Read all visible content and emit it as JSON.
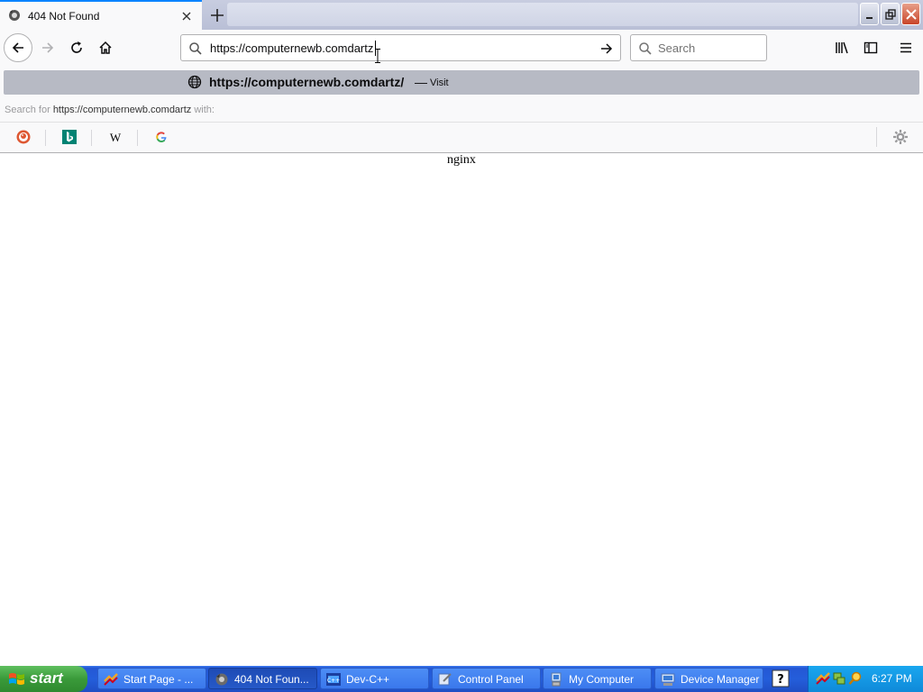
{
  "tab": {
    "title": "404 Not Found"
  },
  "nav": {
    "url": "https://computernewb.comdartz"
  },
  "search": {
    "placeholder": "Search"
  },
  "dropdown": {
    "suggestion_url": "https://computernewb.comdartz/",
    "suggestion_dash": "—",
    "suggestion_action": "Visit",
    "search_for_prefix": "Search for",
    "search_for_query": "https://computernewb.comdartz",
    "search_for_suffix": "with:",
    "engines": [
      "duckduckgo-icon",
      "bing-icon",
      "wikipedia-icon",
      "google-icon"
    ]
  },
  "page": {
    "server_text": "nginx"
  },
  "taskbar": {
    "start_label": "start",
    "tasks": [
      {
        "label": "Start Page - ...",
        "icon": "devcpp-icon"
      },
      {
        "label": "404 Not Foun...",
        "icon": "firefox-icon"
      },
      {
        "label": "Dev-C++",
        "icon": "devcpp-icon"
      },
      {
        "label": "Control Panel",
        "icon": "control-panel-icon"
      },
      {
        "label": "My Computer",
        "icon": "my-computer-icon"
      },
      {
        "label": "Device Manager",
        "icon": "device-manager-icon"
      }
    ],
    "clock": "6:27 PM"
  },
  "colors": {
    "accent": "#0a84ff",
    "taskbar": "#245edb",
    "start": "#3a9a3a",
    "tray": "#0f8ad9"
  }
}
